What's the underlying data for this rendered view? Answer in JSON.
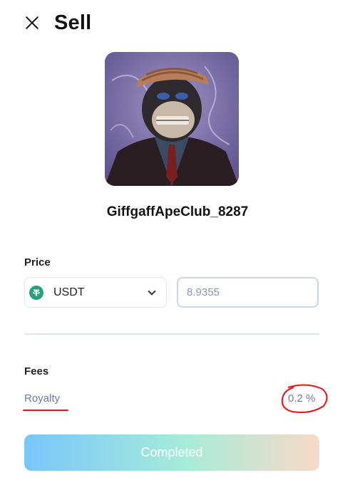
{
  "header": {
    "title": "Sell",
    "close_icon": "close-icon"
  },
  "nft": {
    "name": "GiffgaffApeClub_8287",
    "image_alt": "ape-nft-avatar"
  },
  "price": {
    "label": "Price",
    "currency": {
      "symbol": "USDT",
      "icon": "tether-icon",
      "icon_color": "#26a17b"
    },
    "amount": "8.9355"
  },
  "fees": {
    "label": "Fees",
    "royalty_label": "Royalty",
    "royalty_value": "0.2 %"
  },
  "actions": {
    "complete_label": "Completed"
  },
  "colors": {
    "accent_text": "#6b7aa8",
    "annotation_red": "#e11111",
    "button_gradient": [
      "#78c6fb",
      "#a6ecd8",
      "#f9d9c7"
    ]
  }
}
